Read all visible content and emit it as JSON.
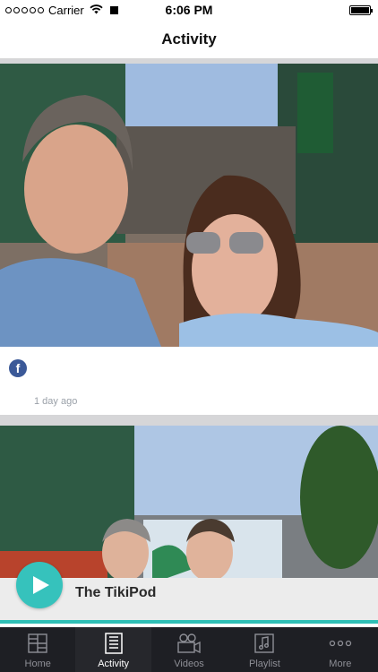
{
  "status_bar": {
    "carrier": "Carrier",
    "time": "6:06 PM"
  },
  "header": {
    "title": "Activity"
  },
  "feed": {
    "posts": [
      {
        "source_icon": "facebook-icon",
        "timestamp": "1 day ago"
      },
      {
        "source_icon": "photo"
      }
    ]
  },
  "player": {
    "title": "The TikiPod",
    "accent_color": "#36c2bc"
  },
  "tabs": [
    {
      "label": "Home",
      "icon": "grid-icon"
    },
    {
      "label": "Activity",
      "icon": "newsfeed-icon",
      "active": true
    },
    {
      "label": "Videos",
      "icon": "video-camera-icon"
    },
    {
      "label": "Playlist",
      "icon": "music-note-icon"
    },
    {
      "label": "More",
      "icon": "more-dots-icon"
    }
  ],
  "colors": {
    "tab_bar_bg": "#1e1f24",
    "facebook": "#3b5998",
    "feed_bg": "#d6d6d8"
  }
}
